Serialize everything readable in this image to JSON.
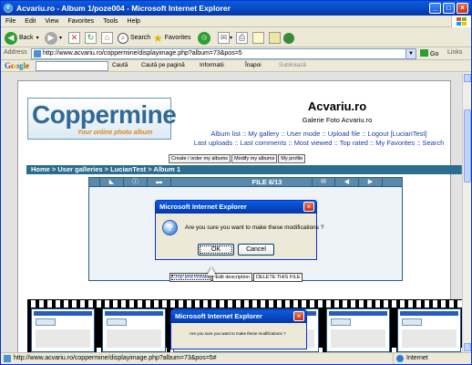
{
  "window": {
    "title": "Acvariu.ro - Album 1/poze004 - Microsoft Internet Explorer",
    "minimize": "_",
    "maximize": "□",
    "close": "×"
  },
  "menu": [
    "File",
    "Edit",
    "View",
    "Favorites",
    "Tools",
    "Help"
  ],
  "toolbar": {
    "back": "Back",
    "search": "Search",
    "favorites": "Favorites"
  },
  "address": {
    "label": "Address",
    "url": "http://www.acvariu.ro/coppermine/displayimage.php?album=73&pos=5",
    "go": "Go",
    "links": "Links"
  },
  "google_bar": {
    "logo": "Google",
    "search": "Caută",
    "search_page": "Caută pe pagină",
    "info": "Informatii",
    "up": "Înapoi",
    "highlight": "Subliniază"
  },
  "site": {
    "logo_text": "Coppermine",
    "logo_sub": "Your online photo album",
    "title": "Acvariu.ro",
    "description": "Galerie Foto Acvariu.ro",
    "nav1": "Album list :: My gallery :: User mode :: Upload file :: Logout [LucianTest]",
    "nav2": "Last uploads :: Last comments :: Most viewed :: Top rated :: My Favorites :: Search",
    "sub_buttons": [
      "Create / order my albums",
      "Modify my albums",
      "My profile"
    ],
    "breadcrumb": "Home > User galleries > LucianTest > Album 1",
    "file_counter": "FILE 6/13",
    "edit_buttons": [
      "Crop and Rotate",
      "Edit description",
      "DELETE THIS FILE"
    ]
  },
  "dialog": {
    "title": "Microsoft Internet Explorer",
    "message": "Are you sure you want to make these modifications ?",
    "ok": "OK",
    "cancel": "Cancel"
  },
  "thumb_dialog": {
    "title": "Microsoft Internet Explorer",
    "message": "Are you sure you want to make these modifications ?"
  },
  "status": {
    "url": "http://www.acvariu.ro/coppermine/displayimage.php?album=73&pos=5#",
    "zone": "Internet"
  },
  "colors": {
    "xp_blue": "#0a5fdb",
    "coppermine_blue": "#2b6d8e",
    "link_blue": "#1a3ea8"
  }
}
